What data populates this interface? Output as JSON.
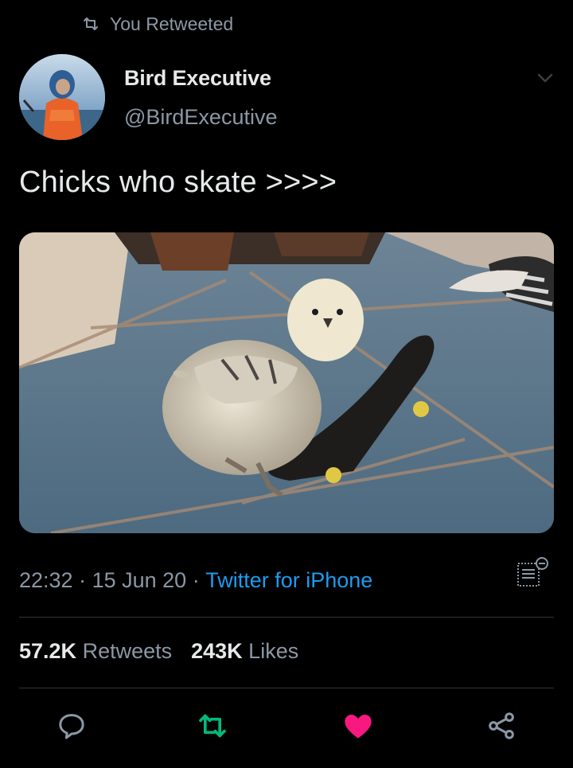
{
  "retweet_context": {
    "label": "You Retweeted",
    "icon": "retweet-icon"
  },
  "author": {
    "display_name": "Bird Executive",
    "handle": "@BirdExecutive",
    "avatar_icon": "avatar-image"
  },
  "tweet": {
    "text": "Chicks who skate >>>>",
    "media_icon": "photo-chick-on-skateboard"
  },
  "meta": {
    "time": "22:32",
    "separator1": " · ",
    "date": "15 Jun 20",
    "separator2": " · ",
    "source": "Twitter for iPhone"
  },
  "stats": {
    "retweets_count": "57.2K",
    "retweets_label": " Retweets",
    "likes_count": "243K",
    "likes_label": " Likes"
  },
  "actions": [
    {
      "name": "reply",
      "icon": "reply-icon"
    },
    {
      "name": "retweet",
      "icon": "retweet-icon",
      "color": "#00ba7c"
    },
    {
      "name": "like",
      "icon": "heart-icon",
      "color": "#f91880"
    },
    {
      "name": "share",
      "icon": "share-icon"
    }
  ],
  "colors": {
    "background": "#000000",
    "accent": "#1d9bf0",
    "muted": "#8b98a5",
    "retweet": "#00ba7c",
    "like": "#f91880"
  }
}
